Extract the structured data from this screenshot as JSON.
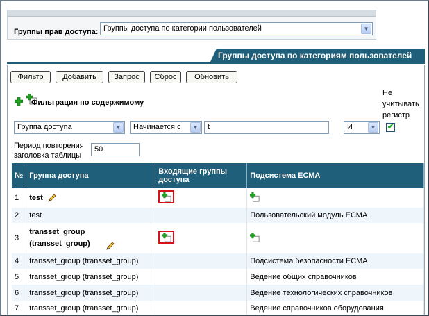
{
  "selector": {
    "label": "Группы прав доступа:",
    "value": "Группы доступа по категории пользователей"
  },
  "section_title": "Группы доступа по категориям пользователей",
  "toolbar": {
    "filter": "Фильтр",
    "add": "Добавить",
    "query": "Запрос",
    "reset": "Сброс",
    "refresh": "Обновить"
  },
  "filter": {
    "title": "Фильтрация по содержимому",
    "case_label": "Не учитывать регистр",
    "field": "Группа доступа",
    "condition": "Начинается с",
    "value": "t",
    "logic": "И",
    "case_checked": true,
    "period_label": "Период повторения заголовка таблицы",
    "period_value": "50"
  },
  "table": {
    "headers": [
      "№",
      "Группа доступа",
      "Входящие группы доступа",
      "Подсистема ЕСМА"
    ],
    "rows": [
      {
        "num": "1",
        "group": "test",
        "subsystem": ""
      },
      {
        "num": "2",
        "group": "test",
        "subsystem": "Пользовательский модуль ЕСМА"
      },
      {
        "num": "3",
        "group": "transset_group (transset_group)",
        "subsystem": ""
      },
      {
        "num": "4",
        "group": "transset_group (transset_group)",
        "subsystem": "Подсистема безопасности ЕСМА"
      },
      {
        "num": "5",
        "group": "transset_group (transset_group)",
        "subsystem": "Ведение общих справочников"
      },
      {
        "num": "6",
        "group": "transset_group (transset_group)",
        "subsystem": "Ведение технологических справочников"
      },
      {
        "num": "7",
        "group": "transset_group (transset_group)",
        "subsystem": "Ведение справочников оборудования"
      }
    ]
  },
  "icons": {
    "add": "add-plus-icon",
    "edit": "pencil-icon",
    "dropdown": "chevron-down-icon"
  },
  "colors": {
    "header": "#1f5f7a",
    "alt_row": "#eef5fb",
    "highlight": "#d5121b",
    "plus": "#21a121"
  }
}
